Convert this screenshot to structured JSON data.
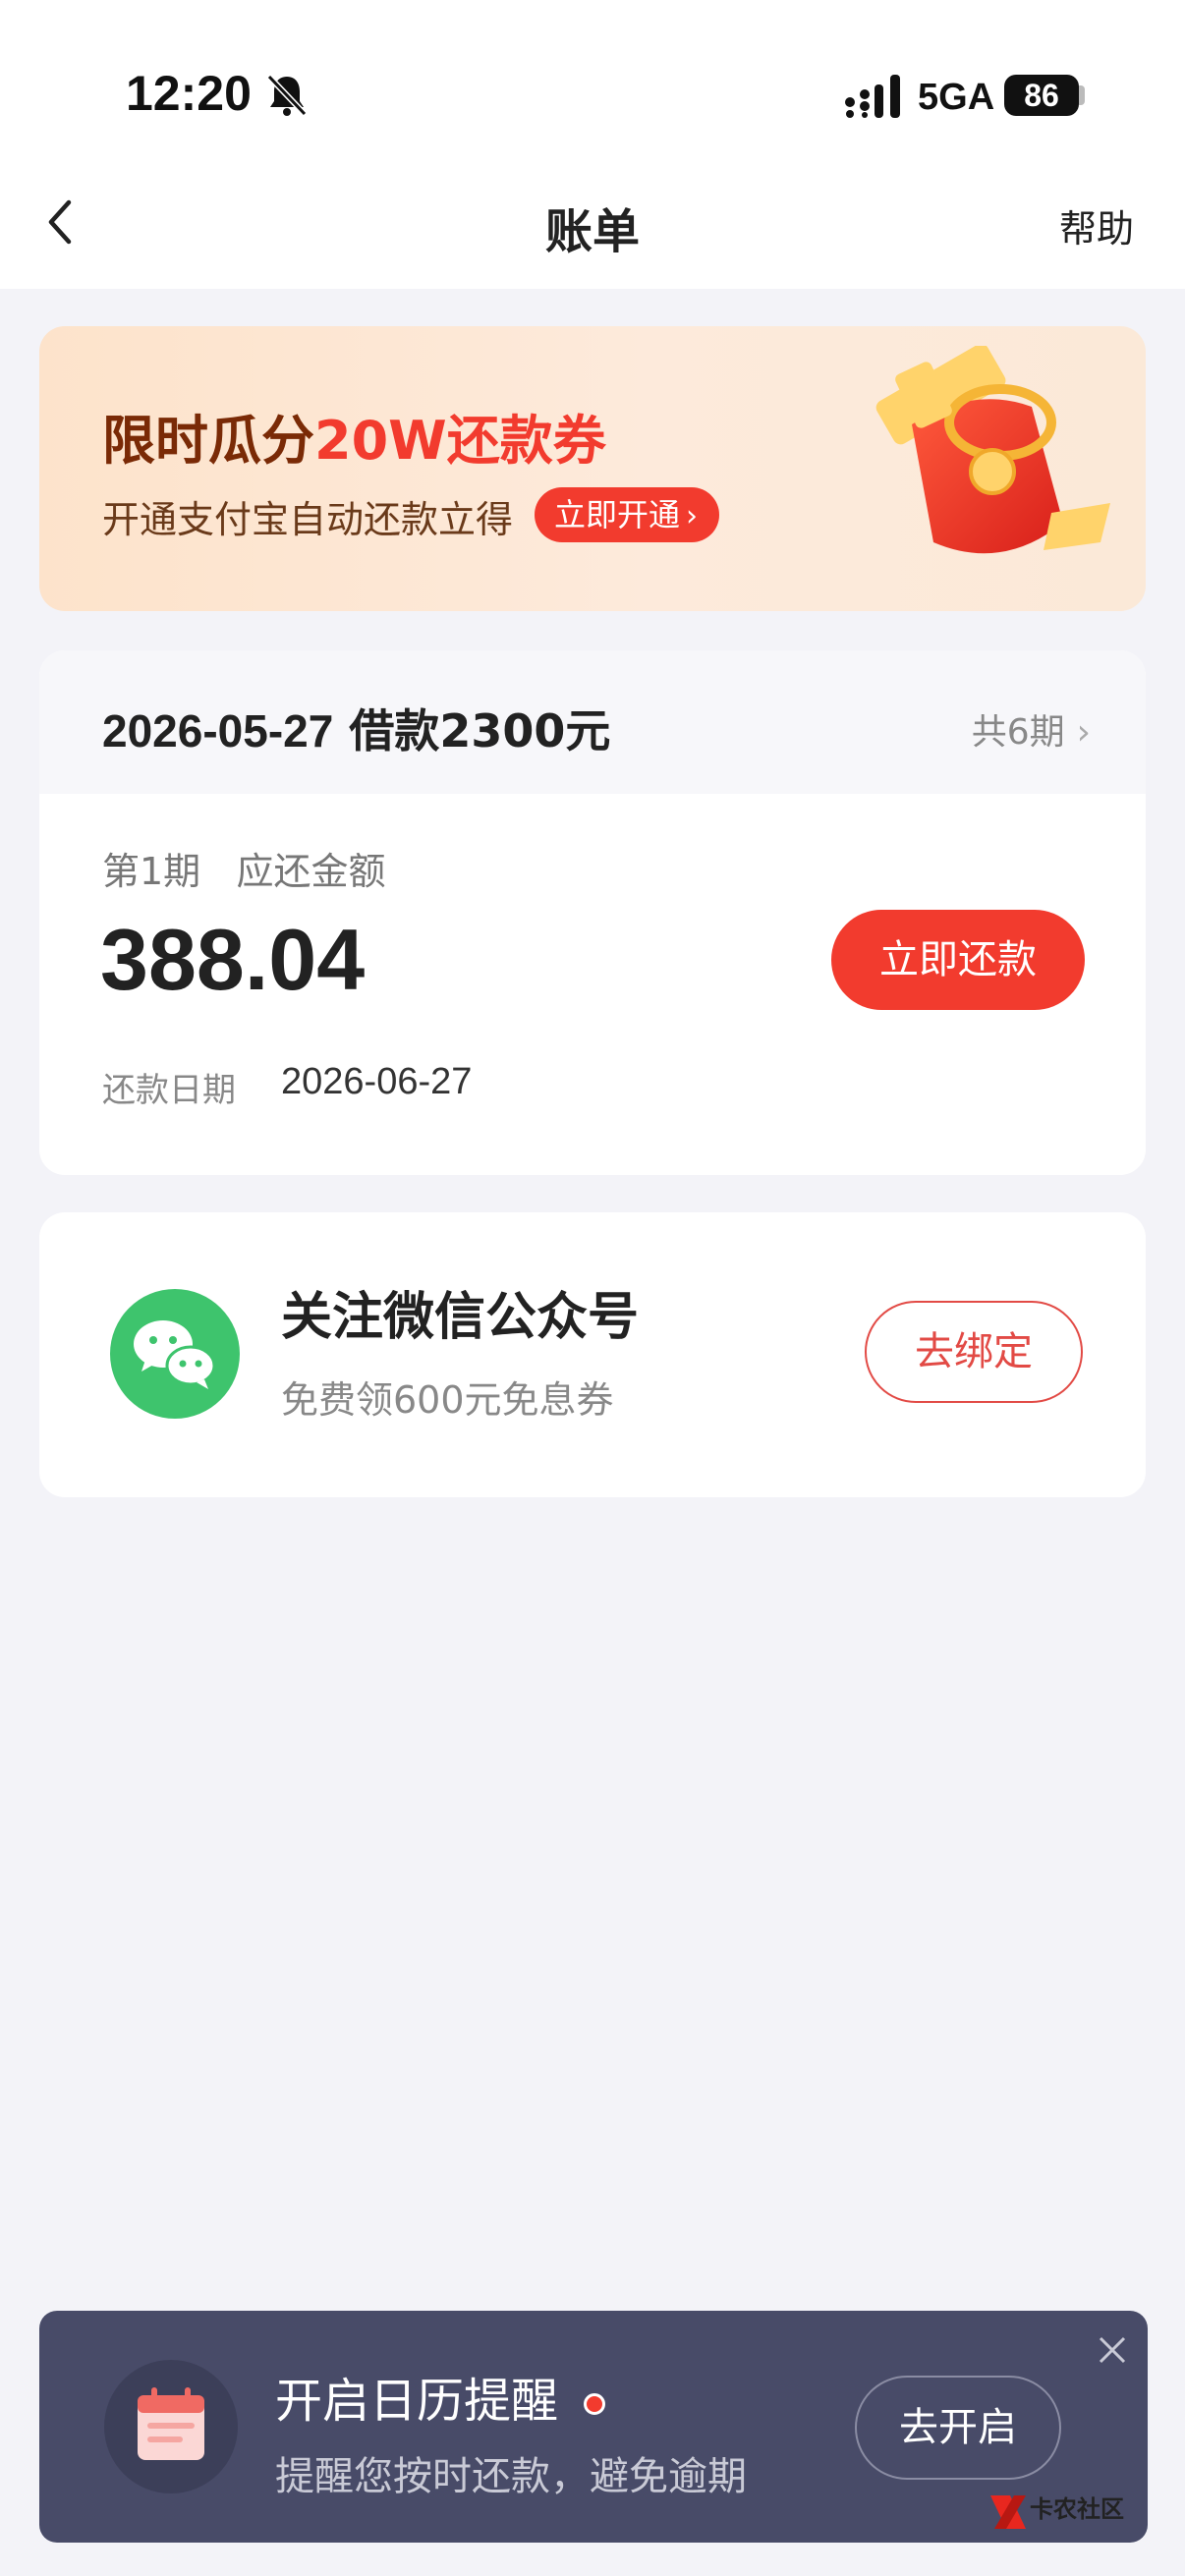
{
  "status_bar": {
    "time": "12:20",
    "network": "5GA",
    "battery": "86"
  },
  "nav": {
    "title": "账单",
    "help": "帮助"
  },
  "banner": {
    "title_part1": "限时瓜分",
    "title_part2": "20W还款券",
    "subtitle": "开通支付宝自动还款立得",
    "button": "立即开通"
  },
  "bill": {
    "header_date": "2026-05-27",
    "header_loan": "借款2300元",
    "installments": "共6期",
    "period_label": "第1期",
    "amount_label": "应还金额",
    "amount": "388.04",
    "repay_button": "立即还款",
    "due_label": "还款日期",
    "due_date": "2026-06-27"
  },
  "wechat": {
    "title": "关注微信公众号",
    "subtitle": "免费领600元免息券",
    "button": "去绑定"
  },
  "reminder": {
    "title": "开启日历提醒",
    "subtitle": "提醒您按时还款，避免逾期",
    "button": "去开启"
  },
  "watermark": "卡农社区",
  "colors": {
    "accent_red": "#f23b2e",
    "wechat_green": "#3ec46d",
    "reminder_bg": "#484b68",
    "page_bg": "#f3f3f8"
  }
}
